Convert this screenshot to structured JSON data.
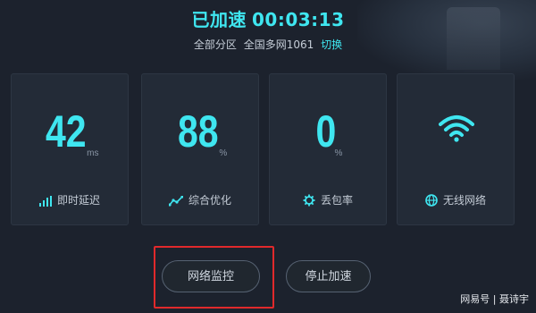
{
  "header": {
    "status": "已加速",
    "timer": "00:03:13",
    "region": "全部分区",
    "line": "全国多网1061",
    "switch_label": "切换"
  },
  "cards": [
    {
      "value": "42",
      "unit": "ms",
      "label": "即时延迟",
      "icon": "signal-bars-icon"
    },
    {
      "value": "88",
      "unit": "%",
      "label": "综合优化",
      "icon": "trend-line-icon"
    },
    {
      "value": "0",
      "unit": "%",
      "label": "丢包率",
      "icon": "gear-icon"
    },
    {
      "value": "",
      "unit": "",
      "label": "无线网络",
      "icon": "wifi-icon"
    }
  ],
  "buttons": {
    "monitor": "网络监控",
    "stop": "停止加速"
  },
  "watermark": "网易号 | 聂诗宇",
  "colors": {
    "accent": "#3fe6f0",
    "background": "#1c222d",
    "card": "#232b37",
    "highlight": "#e0292b"
  }
}
